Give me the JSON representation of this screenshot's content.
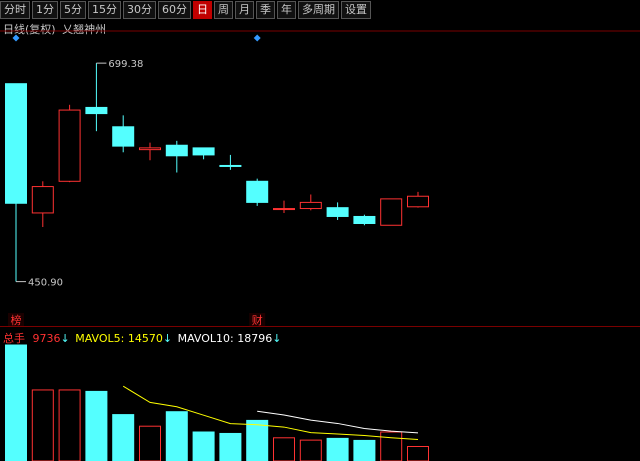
{
  "toolbar": {
    "tabs": [
      "分时",
      "1分",
      "5分",
      "15分",
      "30分",
      "60分",
      "日",
      "周",
      "月",
      "季",
      "年",
      "多周期",
      "设置"
    ],
    "active": "日"
  },
  "header": {
    "title": "日线(复权)",
    "stock": "乂翘神州"
  },
  "colors": {
    "up": "#ff3232",
    "down": "#54ffff",
    "ma5": "#ffff00",
    "ma10": "#ffffff",
    "grid": "#7a0000",
    "marker": "#3399ff"
  },
  "chart_data": {
    "type": "candlestick",
    "candles": [
      {
        "o": 676,
        "h": 676,
        "l": 450.9,
        "c": 540
      },
      {
        "o": 529,
        "h": 565,
        "l": 513,
        "c": 559
      },
      {
        "o": 565,
        "h": 652,
        "l": 564,
        "c": 646
      },
      {
        "o": 649,
        "h": 699.38,
        "l": 622,
        "c": 642
      },
      {
        "o": 627,
        "h": 640,
        "l": 598,
        "c": 605
      },
      {
        "o": 601,
        "h": 609,
        "l": 589,
        "c": 603
      },
      {
        "o": 606,
        "h": 611,
        "l": 575,
        "c": 594
      },
      {
        "o": 603,
        "h": 603,
        "l": 590,
        "c": 595
      },
      {
        "o": 583,
        "h": 595,
        "l": 578,
        "c": 582
      },
      {
        "o": 565,
        "h": 568,
        "l": 537,
        "c": 541
      },
      {
        "o": 534,
        "h": 543,
        "l": 529,
        "c": 534
      },
      {
        "o": 534,
        "h": 550,
        "l": 532,
        "c": 541
      },
      {
        "o": 535,
        "h": 541,
        "l": 521,
        "c": 525
      },
      {
        "o": 525,
        "h": 527,
        "l": 515,
        "c": 517
      },
      {
        "o": 515,
        "h": 545,
        "l": 515,
        "c": 545
      },
      {
        "o": 536,
        "h": 553,
        "l": 535,
        "c": 548
      }
    ],
    "price_labels": {
      "high": "699.38",
      "low": "450.90"
    },
    "markers": [
      {
        "index": 0,
        "text": "榜"
      },
      {
        "index": 9,
        "text": "财"
      }
    ],
    "diamonds": [
      0,
      9
    ],
    "volume": {
      "label": "总手",
      "value": "9736",
      "ma5_label": "MAVOL5:",
      "ma5_value": "14570",
      "ma10_label": "MAVOL10:",
      "ma10_value": "18796",
      "bars": [
        40000,
        24500,
        24500,
        24000,
        16000,
        12000,
        17000,
        10000,
        9500,
        14000,
        8000,
        7200,
        7800,
        7100,
        10000,
        5000
      ],
      "ma5": [
        null,
        null,
        null,
        null,
        25800,
        20200,
        18700,
        15800,
        12900,
        12500,
        11700,
        9800,
        9300,
        8800,
        8000,
        7400
      ],
      "ma10": [
        null,
        null,
        null,
        null,
        null,
        null,
        null,
        null,
        null,
        17150,
        15850,
        14100,
        12950,
        11200,
        10300,
        9700
      ],
      "ylim": [
        0,
        40000
      ]
    },
    "ylim": [
      430,
      720
    ]
  }
}
